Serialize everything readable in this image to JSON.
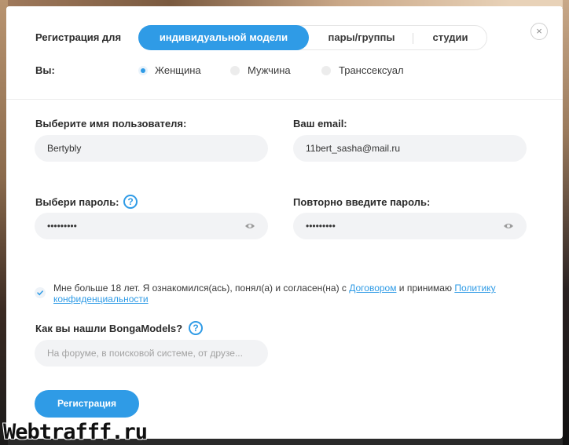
{
  "registration": {
    "label": "Регистрация для",
    "tabs": [
      {
        "label": "индивидуальной модели",
        "active": true
      },
      {
        "label": "пары/группы",
        "active": false
      },
      {
        "label": "студии",
        "active": false
      }
    ],
    "close_glyph": "×"
  },
  "gender": {
    "label": "Вы:",
    "options": [
      {
        "label": "Женщина",
        "checked": true
      },
      {
        "label": "Мужчина",
        "checked": false
      },
      {
        "label": "Транссексуал",
        "checked": false
      }
    ]
  },
  "form": {
    "username": {
      "label": "Выберите имя пользователя:",
      "value": "Bertybly"
    },
    "email": {
      "label": "Ваш email:",
      "value": "11bert_sasha@mail.ru"
    },
    "password": {
      "label": "Выбери пароль:",
      "value": "•••••••••",
      "help_glyph": "?"
    },
    "password_repeat": {
      "label": "Повторно введите пароль:",
      "value": "•••••••••"
    },
    "terms": {
      "text_before": "Мне больше 18 лет. Я ознакомился(ась), понял(а) и согласен(на) с ",
      "agreement_link": "Договором",
      "text_middle": " и принимаю ",
      "policy_link": "Политику конфиденциальности"
    },
    "source": {
      "label": "Как вы нашли BongaModels?",
      "placeholder": "На форуме, в поисковой системе, от друзе...",
      "help_glyph": "?"
    },
    "submit_label": "Регистрация"
  },
  "watermark": "Webtrafff.ru",
  "colors": {
    "accent": "#2f9be6",
    "input_bg": "#f2f3f5"
  }
}
